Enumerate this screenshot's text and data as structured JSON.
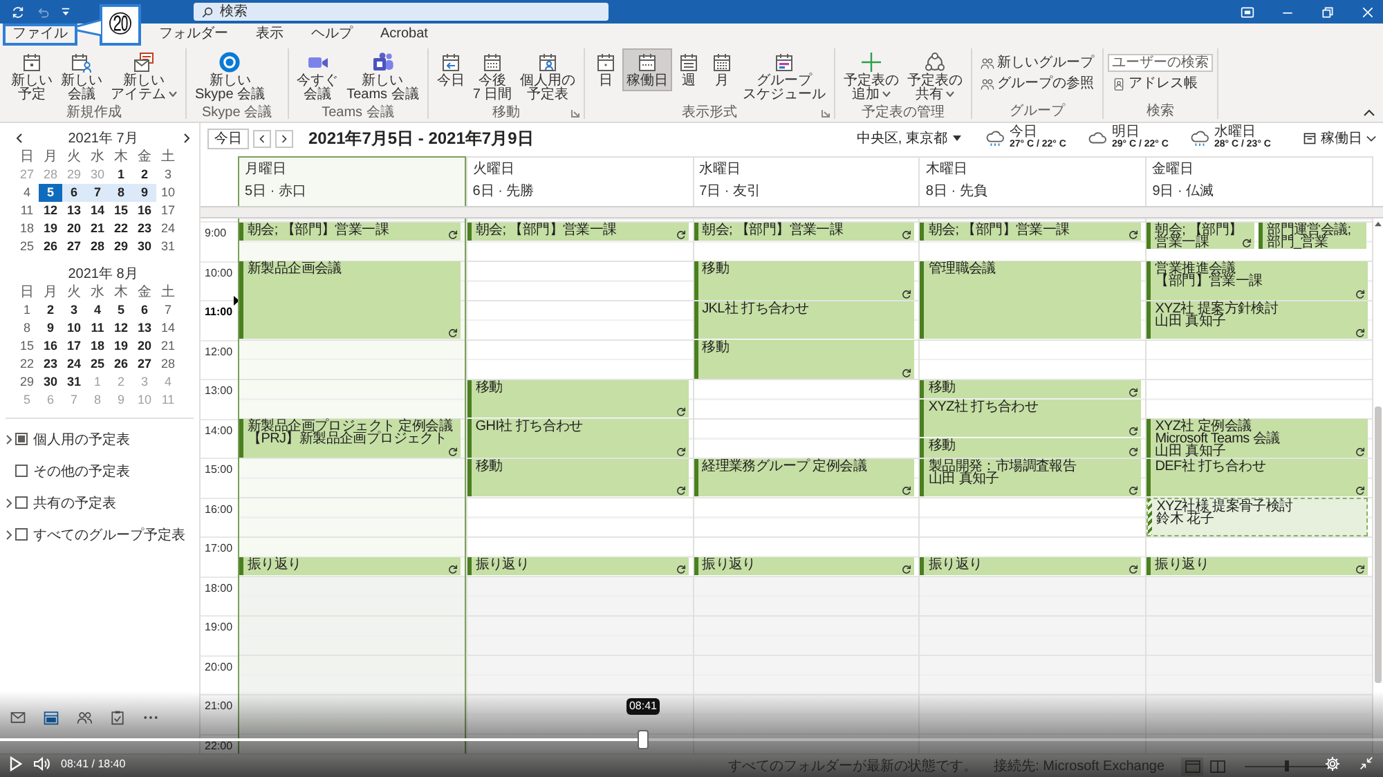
{
  "title_bar": {
    "search": {
      "placeholder": "検索"
    }
  },
  "callout": {
    "label": "⑳"
  },
  "menu_tabs": [
    {
      "label": "ファイル",
      "selected": false,
      "highlighted": true
    },
    {
      "label": "フォルダー",
      "selected": false,
      "highlighted": false
    },
    {
      "label": "表示",
      "selected": false,
      "highlighted": false
    },
    {
      "label": "ヘルプ",
      "selected": false,
      "highlighted": false
    },
    {
      "label": "Acrobat",
      "selected": false,
      "highlighted": false
    }
  ],
  "ribbon": {
    "groups": [
      {
        "label": "新規作成",
        "kind": "large",
        "launcher": false,
        "buttons": [
          {
            "label": "新しい予定",
            "dropdown": false,
            "selected": false
          },
          {
            "label": "新しい会議",
            "dropdown": false,
            "selected": false
          },
          {
            "label": "新しいアイテム",
            "dropdown": true,
            "selected": false
          }
        ]
      },
      {
        "label": "Skype 会議",
        "kind": "large",
        "launcher": false,
        "buttons": [
          {
            "label": "新しい Skype 会議",
            "dropdown": false,
            "selected": false
          }
        ]
      },
      {
        "label": "Teams 会議",
        "kind": "large",
        "launcher": false,
        "buttons": [
          {
            "label": "今すぐ会議",
            "dropdown": false,
            "selected": false
          },
          {
            "label": "新しい Teams 会議",
            "dropdown": false,
            "selected": false
          }
        ]
      },
      {
        "label": "移動",
        "kind": "large",
        "launcher": true,
        "buttons": [
          {
            "label": "今日",
            "dropdown": false,
            "selected": false
          },
          {
            "label": "今後 7 日間",
            "dropdown": false,
            "selected": false
          },
          {
            "label": "個人用の予定表",
            "dropdown": false,
            "selected": false
          }
        ]
      },
      {
        "label": "表示形式",
        "kind": "large",
        "launcher": true,
        "buttons": [
          {
            "label": "日",
            "dropdown": false,
            "selected": false
          },
          {
            "label": "稼働日",
            "dropdown": false,
            "selected": true
          },
          {
            "label": "週",
            "dropdown": false,
            "selected": false
          },
          {
            "label": "月",
            "dropdown": false,
            "selected": false
          },
          {
            "label": "グループスケジュール",
            "dropdown": false,
            "selected": false
          }
        ]
      },
      {
        "label": "予定表の管理",
        "kind": "large",
        "launcher": false,
        "buttons": [
          {
            "label": "予定表の追加",
            "dropdown": true,
            "selected": false
          },
          {
            "label": "予定表の共有",
            "dropdown": true,
            "selected": false
          }
        ]
      },
      {
        "label": "グループ",
        "kind": "small",
        "launcher": false,
        "buttons": [
          {
            "label": "新しいグループ",
            "dropdown": false,
            "selected": false
          },
          {
            "label": "グループの参照",
            "dropdown": false,
            "selected": false
          }
        ]
      },
      {
        "label": "検索",
        "kind": "search",
        "launcher": false,
        "field": {
          "placeholder": "ユーザーの検索"
        },
        "buttons": [
          {
            "label": "アドレス帳",
            "dropdown": false,
            "selected": false
          }
        ]
      }
    ]
  },
  "mini_calendars": [
    {
      "title": "2021年 7月",
      "arrows": true,
      "weekdays": [
        "日",
        "月",
        "火",
        "水",
        "木",
        "金",
        "土"
      ],
      "weeks": [
        [
          {
            "day": "27",
            "kind": "other",
            "selected": false,
            "in_view": false
          },
          {
            "day": "28",
            "kind": "other",
            "selected": false,
            "in_view": false
          },
          {
            "day": "29",
            "kind": "other",
            "selected": false,
            "in_view": false
          },
          {
            "day": "30",
            "kind": "other",
            "selected": false,
            "in_view": false
          },
          {
            "day": "1",
            "kind": "bold",
            "selected": false,
            "in_view": false
          },
          {
            "day": "2",
            "kind": "bold",
            "selected": false,
            "in_view": false
          },
          {
            "day": "3",
            "kind": "weekend",
            "selected": false,
            "in_view": false
          }
        ],
        [
          {
            "day": "4",
            "kind": "weekend",
            "selected": false,
            "in_view": false
          },
          {
            "day": "5",
            "kind": "bold",
            "selected": true,
            "in_view": true
          },
          {
            "day": "6",
            "kind": "bold",
            "selected": false,
            "in_view": true
          },
          {
            "day": "7",
            "kind": "bold",
            "selected": false,
            "in_view": true
          },
          {
            "day": "8",
            "kind": "bold",
            "selected": false,
            "in_view": true
          },
          {
            "day": "9",
            "kind": "bold",
            "selected": false,
            "in_view": true
          },
          {
            "day": "10",
            "kind": "weekend",
            "selected": false,
            "in_view": false
          }
        ],
        [
          {
            "day": "11",
            "kind": "weekend",
            "selected": false,
            "in_view": false
          },
          {
            "day": "12",
            "kind": "bold",
            "selected": false,
            "in_view": false
          },
          {
            "day": "13",
            "kind": "bold",
            "selected": false,
            "in_view": false
          },
          {
            "day": "14",
            "kind": "bold",
            "selected": false,
            "in_view": false
          },
          {
            "day": "15",
            "kind": "bold",
            "selected": false,
            "in_view": false
          },
          {
            "day": "16",
            "kind": "bold",
            "selected": false,
            "in_view": false
          },
          {
            "day": "17",
            "kind": "weekend",
            "selected": false,
            "in_view": false
          }
        ],
        [
          {
            "day": "18",
            "kind": "weekend",
            "selected": false,
            "in_view": false
          },
          {
            "day": "19",
            "kind": "bold",
            "selected": false,
            "in_view": false
          },
          {
            "day": "20",
            "kind": "bold",
            "selected": false,
            "in_view": false
          },
          {
            "day": "21",
            "kind": "bold",
            "selected": false,
            "in_view": false
          },
          {
            "day": "22",
            "kind": "bold",
            "selected": false,
            "in_view": false
          },
          {
            "day": "23",
            "kind": "bold",
            "selected": false,
            "in_view": false
          },
          {
            "day": "24",
            "kind": "weekend",
            "selected": false,
            "in_view": false
          }
        ],
        [
          {
            "day": "25",
            "kind": "weekend",
            "selected": false,
            "in_view": false
          },
          {
            "day": "26",
            "kind": "bold",
            "selected": false,
            "in_view": false
          },
          {
            "day": "27",
            "kind": "bold",
            "selected": false,
            "in_view": false
          },
          {
            "day": "28",
            "kind": "bold",
            "selected": false,
            "in_view": false
          },
          {
            "day": "29",
            "kind": "bold",
            "selected": false,
            "in_view": false
          },
          {
            "day": "30",
            "kind": "bold",
            "selected": false,
            "in_view": false
          },
          {
            "day": "31",
            "kind": "weekend",
            "selected": false,
            "in_view": false
          }
        ]
      ]
    },
    {
      "title": "2021年 8月",
      "arrows": false,
      "weekdays": [
        "日",
        "月",
        "火",
        "水",
        "木",
        "金",
        "土"
      ],
      "weeks": [
        [
          {
            "day": "1",
            "kind": "weekend",
            "selected": false,
            "in_view": false
          },
          {
            "day": "2",
            "kind": "bold",
            "selected": false,
            "in_view": false
          },
          {
            "day": "3",
            "kind": "bold",
            "selected": false,
            "in_view": false
          },
          {
            "day": "4",
            "kind": "bold",
            "selected": false,
            "in_view": false
          },
          {
            "day": "5",
            "kind": "bold",
            "selected": false,
            "in_view": false
          },
          {
            "day": "6",
            "kind": "bold",
            "selected": false,
            "in_view": false
          },
          {
            "day": "7",
            "kind": "weekend",
            "selected": false,
            "in_view": false
          }
        ],
        [
          {
            "day": "8",
            "kind": "weekend",
            "selected": false,
            "in_view": false
          },
          {
            "day": "9",
            "kind": "bold",
            "selected": false,
            "in_view": false
          },
          {
            "day": "10",
            "kind": "bold",
            "selected": false,
            "in_view": false
          },
          {
            "day": "11",
            "kind": "bold",
            "selected": false,
            "in_view": false
          },
          {
            "day": "12",
            "kind": "bold",
            "selected": false,
            "in_view": false
          },
          {
            "day": "13",
            "kind": "bold",
            "selected": false,
            "in_view": false
          },
          {
            "day": "14",
            "kind": "weekend",
            "selected": false,
            "in_view": false
          }
        ],
        [
          {
            "day": "15",
            "kind": "weekend",
            "selected": false,
            "in_view": false
          },
          {
            "day": "16",
            "kind": "bold",
            "selected": false,
            "in_view": false
          },
          {
            "day": "17",
            "kind": "bold",
            "selected": false,
            "in_view": false
          },
          {
            "day": "18",
            "kind": "bold",
            "selected": false,
            "in_view": false
          },
          {
            "day": "19",
            "kind": "bold",
            "selected": false,
            "in_view": false
          },
          {
            "day": "20",
            "kind": "bold",
            "selected": false,
            "in_view": false
          },
          {
            "day": "21",
            "kind": "weekend",
            "selected": false,
            "in_view": false
          }
        ],
        [
          {
            "day": "22",
            "kind": "weekend",
            "selected": false,
            "in_view": false
          },
          {
            "day": "23",
            "kind": "bold",
            "selected": false,
            "in_view": false
          },
          {
            "day": "24",
            "kind": "bold",
            "selected": false,
            "in_view": false
          },
          {
            "day": "25",
            "kind": "bold",
            "selected": false,
            "in_view": false
          },
          {
            "day": "26",
            "kind": "bold",
            "selected": false,
            "in_view": false
          },
          {
            "day": "27",
            "kind": "bold",
            "selected": false,
            "in_view": false
          },
          {
            "day": "28",
            "kind": "weekend",
            "selected": false,
            "in_view": false
          }
        ],
        [
          {
            "day": "29",
            "kind": "weekend",
            "selected": false,
            "in_view": false
          },
          {
            "day": "30",
            "kind": "bold",
            "selected": false,
            "in_view": false
          },
          {
            "day": "31",
            "kind": "bold",
            "selected": false,
            "in_view": false
          },
          {
            "day": "1",
            "kind": "other",
            "selected": false,
            "in_view": false
          },
          {
            "day": "2",
            "kind": "other",
            "selected": false,
            "in_view": false
          },
          {
            "day": "3",
            "kind": "other",
            "selected": false,
            "in_view": false
          },
          {
            "day": "4",
            "kind": "other",
            "selected": false,
            "in_view": false
          }
        ],
        [
          {
            "day": "5",
            "kind": "other",
            "selected": false,
            "in_view": false
          },
          {
            "day": "6",
            "kind": "other",
            "selected": false,
            "in_view": false
          },
          {
            "day": "7",
            "kind": "other",
            "selected": false,
            "in_view": false
          },
          {
            "day": "8",
            "kind": "other",
            "selected": false,
            "in_view": false
          },
          {
            "day": "9",
            "kind": "other",
            "selected": false,
            "in_view": false
          },
          {
            "day": "10",
            "kind": "other",
            "selected": false,
            "in_view": false
          },
          {
            "day": "11",
            "kind": "other",
            "selected": false,
            "in_view": false
          }
        ]
      ]
    }
  ],
  "folders": [
    {
      "label": "個人用の予定表",
      "checked": true,
      "expandable": true
    },
    {
      "label": "その他の予定表",
      "checked": false,
      "expandable": false
    },
    {
      "label": "共有の予定表",
      "checked": false,
      "expandable": true
    },
    {
      "label": "すべてのグループ予定表",
      "checked": false,
      "expandable": true
    }
  ],
  "nav_bar": [
    {
      "selected": false
    },
    {
      "selected": true
    },
    {
      "selected": false
    },
    {
      "selected": false
    },
    {
      "selected": false
    }
  ],
  "calendar": {
    "today_button": "今日",
    "title": "2021年7月5日 - 2021年7月9日",
    "location": "中央区, 東京都",
    "weather": [
      {
        "day": "今日",
        "temp": "27° C / 22° C",
        "kind": "rain"
      },
      {
        "day": "明日",
        "temp": "29° C / 22° C",
        "kind": "cloud"
      },
      {
        "day": "水曜日",
        "temp": "28° C / 23° C",
        "kind": "rain"
      }
    ],
    "view": "稼働日",
    "times": [
      {
        "label": "9:00",
        "current": false
      },
      {
        "label": "10:00",
        "current": false
      },
      {
        "label": "11:00",
        "current": true
      },
      {
        "label": "12:00",
        "current": false
      },
      {
        "label": "13:00",
        "current": false
      },
      {
        "label": "14:00",
        "current": false
      },
      {
        "label": "15:00",
        "current": false
      },
      {
        "label": "16:00",
        "current": false
      },
      {
        "label": "17:00",
        "current": false
      },
      {
        "label": "18:00",
        "current": false
      },
      {
        "label": "19:00",
        "current": false
      },
      {
        "label": "20:00",
        "current": false
      },
      {
        "label": "21:00",
        "current": false
      },
      {
        "label": "22:00",
        "current": false
      }
    ],
    "days": [
      {
        "name": "月曜日",
        "date": "5日 · 赤口",
        "selected": true,
        "blocks": [
          {
            "kind": "half",
            "events": [
              {
                "lines": [
                  "朝会; 【部門】営業一課"
                ],
                "recurring": true,
                "tentative": false
              }
            ]
          },
          {
            "kind": "free"
          },
          {
            "kind": "double",
            "events": [
              {
                "lines": [
                  "新製品企画会議"
                ],
                "recurring": true,
                "tentative": false
              }
            ]
          },
          {
            "kind": "free"
          },
          {
            "kind": "free"
          },
          {
            "kind": "free"
          },
          {
            "kind": "free"
          },
          {
            "kind": "hour",
            "events": [
              {
                "lines": [
                  "新製品企画プロジェクト 定例会議",
                  "【PRJ】新製品企画プロジェクト"
                ],
                "recurring": true,
                "tentative": false
              }
            ]
          },
          {
            "kind": "free"
          },
          {
            "kind": "free"
          },
          {
            "kind": "free"
          },
          {
            "kind": "free"
          },
          {
            "kind": "free"
          },
          {
            "kind": "half",
            "events": [
              {
                "lines": [
                  "振り返り"
                ],
                "recurring": true,
                "tentative": false
              }
            ]
          }
        ]
      },
      {
        "name": "火曜日",
        "date": "6日 · 先勝",
        "selected": false,
        "blocks": [
          {
            "kind": "half",
            "events": [
              {
                "lines": [
                  "朝会; 【部門】営業一課"
                ],
                "recurring": true,
                "tentative": false
              }
            ]
          },
          {
            "kind": "free"
          },
          {
            "kind": "free"
          },
          {
            "kind": "free"
          },
          {
            "kind": "free"
          },
          {
            "kind": "free"
          },
          {
            "kind": "free"
          },
          {
            "kind": "free"
          },
          {
            "kind": "hour",
            "events": [
              {
                "lines": [
                  "移動"
                ],
                "recurring": true,
                "tentative": false
              }
            ]
          },
          {
            "kind": "hour",
            "events": [
              {
                "lines": [
                  "GHI社 打ち合わせ"
                ],
                "recurring": true,
                "tentative": false
              }
            ]
          },
          {
            "kind": "hour",
            "events": [
              {
                "lines": [
                  "移動"
                ],
                "recurring": true,
                "tentative": false
              }
            ]
          },
          {
            "kind": "free"
          },
          {
            "kind": "free"
          },
          {
            "kind": "free"
          },
          {
            "kind": "half",
            "events": [
              {
                "lines": [
                  "振り返り"
                ],
                "recurring": true,
                "tentative": false
              }
            ]
          }
        ]
      },
      {
        "name": "水曜日",
        "date": "7日 · 友引",
        "selected": false,
        "blocks": [
          {
            "kind": "half",
            "events": [
              {
                "lines": [
                  "朝会; 【部門】営業一課"
                ],
                "recurring": true,
                "tentative": false
              }
            ]
          },
          {
            "kind": "free"
          },
          {
            "kind": "hour",
            "events": [
              {
                "lines": [
                  "移動"
                ],
                "recurring": true,
                "tentative": false
              }
            ]
          },
          {
            "kind": "hour",
            "events": [
              {
                "lines": [
                  "JKL社 打ち合わせ"
                ],
                "recurring": false,
                "tentative": false
              }
            ]
          },
          {
            "kind": "hour",
            "events": [
              {
                "lines": [
                  "移動"
                ],
                "recurring": true,
                "tentative": false
              }
            ]
          },
          {
            "kind": "free"
          },
          {
            "kind": "free"
          },
          {
            "kind": "free"
          },
          {
            "kind": "free"
          },
          {
            "kind": "hour",
            "events": [
              {
                "lines": [
                  "経理業務グループ 定例会議"
                ],
                "recurring": true,
                "tentative": false
              }
            ]
          },
          {
            "kind": "free"
          },
          {
            "kind": "free"
          },
          {
            "kind": "free"
          },
          {
            "kind": "half",
            "events": [
              {
                "lines": [
                  "振り返り"
                ],
                "recurring": true,
                "tentative": false
              }
            ]
          }
        ]
      },
      {
        "name": "木曜日",
        "date": "8日 · 先負",
        "selected": false,
        "blocks": [
          {
            "kind": "half",
            "events": [
              {
                "lines": [
                  "朝会; 【部門】営業一課"
                ],
                "recurring": true,
                "tentative": false
              }
            ]
          },
          {
            "kind": "free"
          },
          {
            "kind": "double",
            "events": [
              {
                "lines": [
                  "管理職会議"
                ],
                "recurring": false,
                "tentative": false
              }
            ]
          },
          {
            "kind": "free"
          },
          {
            "kind": "free"
          },
          {
            "kind": "half",
            "events": [
              {
                "lines": [
                  "移動"
                ],
                "recurring": true,
                "tentative": false
              }
            ]
          },
          {
            "kind": "hour",
            "events": [
              {
                "lines": [
                  "XYZ社 打ち合わせ"
                ],
                "recurring": true,
                "tentative": false
              }
            ]
          },
          {
            "kind": "half",
            "events": [
              {
                "lines": [
                  "移動"
                ],
                "recurring": true,
                "tentative": false
              }
            ]
          },
          {
            "kind": "hour",
            "events": [
              {
                "lines": [
                  "製品開発：市場調査報告",
                  "山田 真知子"
                ],
                "recurring": true,
                "tentative": false
              }
            ]
          },
          {
            "kind": "free"
          },
          {
            "kind": "free"
          },
          {
            "kind": "free"
          },
          {
            "kind": "half",
            "events": [
              {
                "lines": [
                  "振り返り"
                ],
                "recurring": true,
                "tentative": false
              }
            ]
          }
        ]
      },
      {
        "name": "金曜日",
        "date": "9日 · 仏滅",
        "selected": false,
        "blocks": [
          {
            "kind": "half",
            "events": [
              {
                "lines": [
                  "朝会; 【部門】営業一課"
                ],
                "recurring": true,
                "tentative": false
              },
              {
                "lines": [
                  "部門運営会議; 部門_営業"
                ],
                "recurring": false,
                "tentative": false
              }
            ]
          },
          {
            "kind": "free"
          },
          {
            "kind": "hour",
            "events": [
              {
                "lines": [
                  "営業推進会議",
                  "【部門】営業一課"
                ],
                "recurring": true,
                "tentative": false
              }
            ]
          },
          {
            "kind": "hour",
            "events": [
              {
                "lines": [
                  "XYZ社 提案方針検討",
                  "山田 真知子"
                ],
                "recurring": true,
                "tentative": false
              }
            ]
          },
          {
            "kind": "free"
          },
          {
            "kind": "free"
          },
          {
            "kind": "free"
          },
          {
            "kind": "free"
          },
          {
            "kind": "hour",
            "events": [
              {
                "lines": [
                  "XYZ社 定例会議",
                  "Microsoft Teams 会議",
                  "山田 真知子"
                ],
                "recurring": true,
                "tentative": false
              }
            ]
          },
          {
            "kind": "hour",
            "events": [
              {
                "lines": [
                  "DEF社 打ち合わせ"
                ],
                "recurring": true,
                "tentative": false
              }
            ]
          },
          {
            "kind": "hour",
            "events": [
              {
                "lines": [
                  "XYZ社様 提案骨子検討",
                  "鈴木 花子"
                ],
                "recurring": false,
                "tentative": true
              }
            ]
          },
          {
            "kind": "free"
          },
          {
            "kind": "half",
            "events": [
              {
                "lines": [
                  "振り返り"
                ],
                "recurring": true,
                "tentative": false
              }
            ]
          }
        ]
      }
    ]
  },
  "status_bar": {
    "texts": [
      "すべてのフォルダーが最新の状態です。",
      "接続先: Microsoft Exchange"
    ],
    "views": [
      {
        "selected": true
      },
      {
        "selected": false
      }
    ],
    "zoom": {
      "level": 0.5
    }
  },
  "video_player": {
    "tooltip": "08:41",
    "time": "08:41 / 18:40",
    "level": 0.465
  }
}
